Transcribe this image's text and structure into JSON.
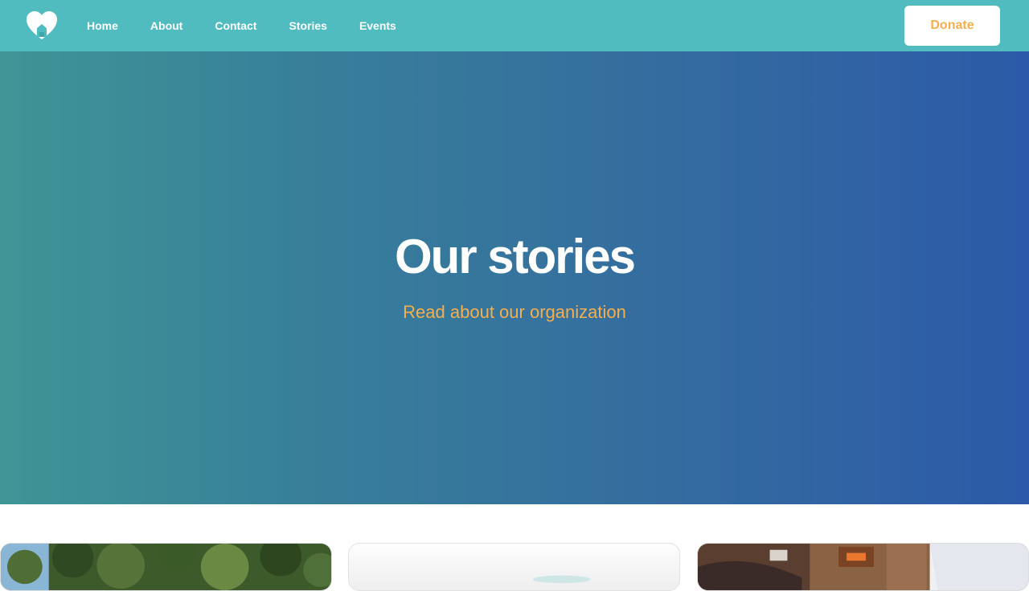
{
  "nav": {
    "links": [
      {
        "label": "Home"
      },
      {
        "label": "About"
      },
      {
        "label": "Contact"
      },
      {
        "label": "Stories"
      },
      {
        "label": "Events"
      }
    ],
    "donate_label": "Donate",
    "logo_icon": "heart-home-icon"
  },
  "hero": {
    "title": "Our stories",
    "subtitle": "Read about our organization"
  },
  "colors": {
    "navbar": "#50bcc0",
    "accent": "#f5ae4e",
    "hero_start": "#3f9596",
    "hero_end": "#2c5aa8"
  }
}
